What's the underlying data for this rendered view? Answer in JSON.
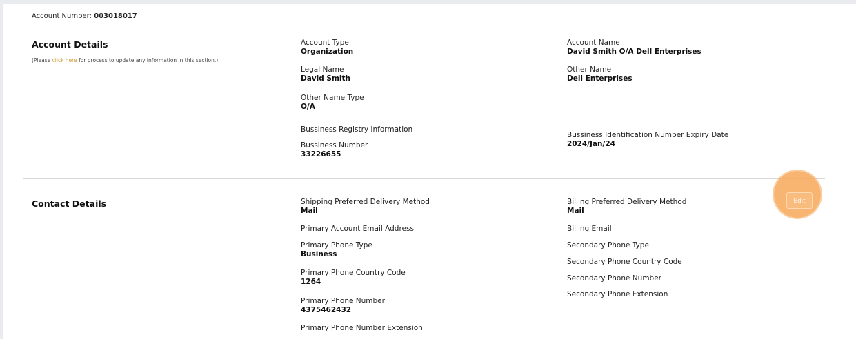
{
  "account_number": {
    "label": "Account Number:",
    "value": "003018017"
  },
  "account_details": {
    "title": "Account Details",
    "note_prefix": "(Please",
    "note_link": "click here",
    "note_suffix": "for process to update any information in this section.)",
    "fields": {
      "account_type": {
        "label": "Account Type",
        "value": "Organization"
      },
      "account_name": {
        "label": "Account Name",
        "value": "David Smith O/A Dell Enterprises"
      },
      "legal_name": {
        "label": "Legal Name",
        "value": "David Smith"
      },
      "other_name": {
        "label": "Other Name",
        "value": "Dell Enterprises"
      },
      "other_name_type": {
        "label": "Other Name Type",
        "value": "O/A"
      },
      "registry_info": {
        "label": "Bussiness Registry Information"
      },
      "business_number": {
        "label": "Bussiness Number",
        "value": "33226655"
      },
      "bin_expiry": {
        "label": "Bussiness Identification Number Expiry Date",
        "value": "2024/Jan/24"
      }
    }
  },
  "contact_details": {
    "title": "Contact Details",
    "edit_label": "Edit",
    "fields": {
      "shipping_delivery": {
        "label": "Shipping Preferred Delivery Method",
        "value": "Mail"
      },
      "billing_delivery": {
        "label": "Billing Preferred Delivery Method",
        "value": "Mail"
      },
      "primary_email": {
        "label": "Primary Account Email Address"
      },
      "billing_email": {
        "label": "Billing Email"
      },
      "primary_phone_type": {
        "label": "Primary Phone Type",
        "value": "Business"
      },
      "secondary_phone_type": {
        "label": "Secondary Phone Type"
      },
      "primary_country_code": {
        "label": "Primary Phone Country Code",
        "value": "1264"
      },
      "secondary_country_code": {
        "label": "Secondary Phone Country Code"
      },
      "secondary_phone_number": {
        "label": "Secondary Phone Number"
      },
      "secondary_extension": {
        "label": "Secondary Phone Extension"
      },
      "primary_phone_number": {
        "label": "Primary Phone Number",
        "value": "4375462432"
      },
      "primary_extension": {
        "label": "Primary Phone Number Extension"
      }
    }
  },
  "colors": {
    "link": "#c99a2e",
    "highlight": "#f7a858"
  }
}
